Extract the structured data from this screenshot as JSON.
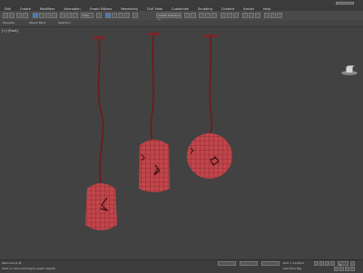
{
  "menu": {
    "items": [
      "Edit",
      "Create",
      "Modifiers",
      "Animation",
      "Graph Editors",
      "Rendering",
      "Civil View",
      "Customize",
      "Scripting",
      "Content",
      "Arnold",
      "Help"
    ]
  },
  "toolbar": {
    "view_select": "View",
    "selection_set": "Create Selection Se"
  },
  "subbar": {
    "tab1": "Populate",
    "tab2": "Object Paint",
    "tab3": "Selection"
  },
  "viewport": {
    "label": "[+] [Front]"
  },
  "status": {
    "prompt": "Click or click-and-drag to select objects",
    "welcome": "Welcome to M",
    "grid": "Grid = 10.0mm",
    "add_time_tag": "Add Time Tag",
    "frame": "0"
  },
  "colors": {
    "lamp_fill": "#c0464b",
    "wire": "#6e1a1e",
    "ui_accent": "#3f7ac4"
  }
}
